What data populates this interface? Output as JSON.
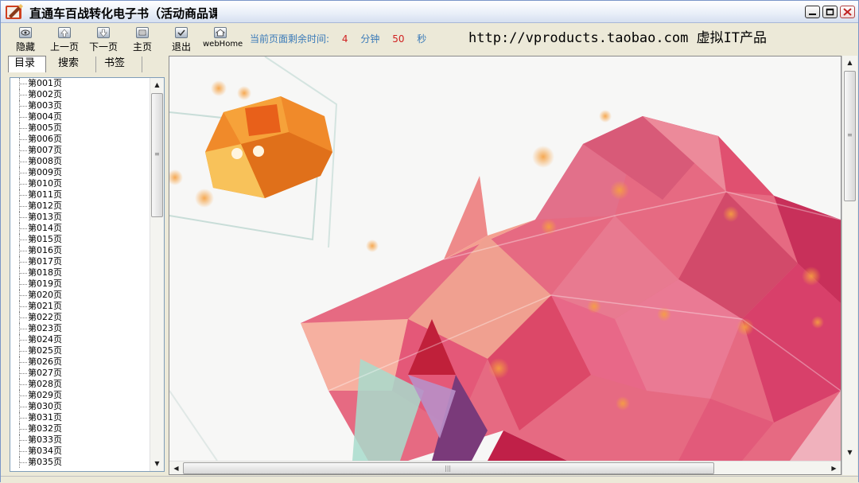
{
  "window": {
    "title": "直通车百战转化电子书（活动商品课",
    "icon": "ebook-app-icon"
  },
  "toolbar": {
    "buttons": [
      {
        "label": "隐藏",
        "icon": "eye-icon"
      },
      {
        "label": "上一页",
        "icon": "arrow-up-icon"
      },
      {
        "label": "下一页",
        "icon": "arrow-down-icon"
      },
      {
        "label": "主页",
        "icon": "home-page-icon"
      },
      {
        "label": "退出",
        "icon": "checkmark-icon"
      },
      {
        "label": "webHome",
        "icon": "house-icon"
      }
    ],
    "timer": {
      "label": "当前页面剩余时间:",
      "minutes": "4",
      "minutes_unit": "分钟",
      "seconds": "50",
      "seconds_unit": "秒"
    },
    "url_text": "http://vproducts.taobao.com 虚拟IT产品"
  },
  "left_panel": {
    "tabs": [
      "目录",
      "搜索",
      "书签"
    ],
    "active_tab": "目录",
    "tree_items": [
      "第001页",
      "第002页",
      "第003页",
      "第004页",
      "第005页",
      "第006页",
      "第007页",
      "第008页",
      "第009页",
      "第010页",
      "第011页",
      "第012页",
      "第013页",
      "第014页",
      "第015页",
      "第016页",
      "第017页",
      "第018页",
      "第019页",
      "第020页",
      "第021页",
      "第022页",
      "第023页",
      "第024页",
      "第025页",
      "第026页",
      "第027页",
      "第028页",
      "第029页",
      "第030页",
      "第031页",
      "第032页",
      "第033页",
      "第034页",
      "第035页"
    ]
  },
  "colors": {
    "timer_label": "#3a7ab8",
    "timer_number": "#d02020",
    "art_pink": "#e05a7a",
    "art_orange": "#f08a2a"
  }
}
